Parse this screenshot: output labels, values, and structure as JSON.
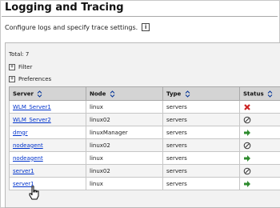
{
  "page": {
    "title": "Logging and Tracing",
    "description": "Configure logs and specify trace settings."
  },
  "panel": {
    "total_label": "Total: 7",
    "filter_label": "Filter",
    "preferences_label": "Preferences"
  },
  "columns": {
    "server": "Server",
    "node": "Node",
    "type": "Type",
    "status": "Status"
  },
  "rows": [
    {
      "server": "WLM_Server1",
      "node": "linux",
      "type": "servers",
      "status": "stopped-error"
    },
    {
      "server": "WLM_Server2",
      "node": "linux02",
      "type": "servers",
      "status": "unavailable"
    },
    {
      "server": "dmgr",
      "node": "linuxManager",
      "type": "servers",
      "status": "started"
    },
    {
      "server": "nodeagent",
      "node": "linux02",
      "type": "servers",
      "status": "unavailable"
    },
    {
      "server": "nodeagent",
      "node": "linux",
      "type": "servers",
      "status": "started"
    },
    {
      "server": "server1",
      "node": "linux02",
      "type": "servers",
      "status": "unavailable"
    },
    {
      "server": "server1",
      "node": "linux",
      "type": "servers",
      "status": "started"
    }
  ],
  "colors": {
    "link": "#0033cc",
    "started": "#2e8b2e",
    "error": "#cc2222",
    "header_bg": "#d4d4d4"
  }
}
